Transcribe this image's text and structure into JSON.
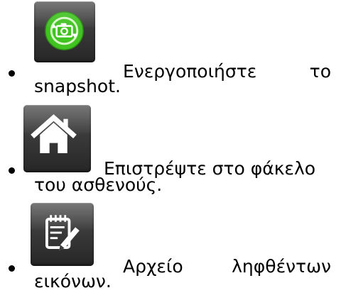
{
  "items": [
    {
      "icon": "camera-snapshot-icon",
      "line1_words": [
        "Ενεργοποιήστε",
        "το"
      ],
      "line2": "snapshot."
    },
    {
      "icon": "home-icon",
      "line1": "Επιστρέψτε στο φάκελο",
      "line2": "του ασθενούς."
    },
    {
      "icon": "notepad-edit-icon",
      "line1_words": [
        "Αρχείο",
        "ληφθέντων"
      ],
      "line2": "εικόνων."
    }
  ],
  "colors": {
    "text": "#000000",
    "icon_tile": "#3a3a3a",
    "camera_green": "#3fbf1f",
    "icon_white": "#ffffff"
  }
}
